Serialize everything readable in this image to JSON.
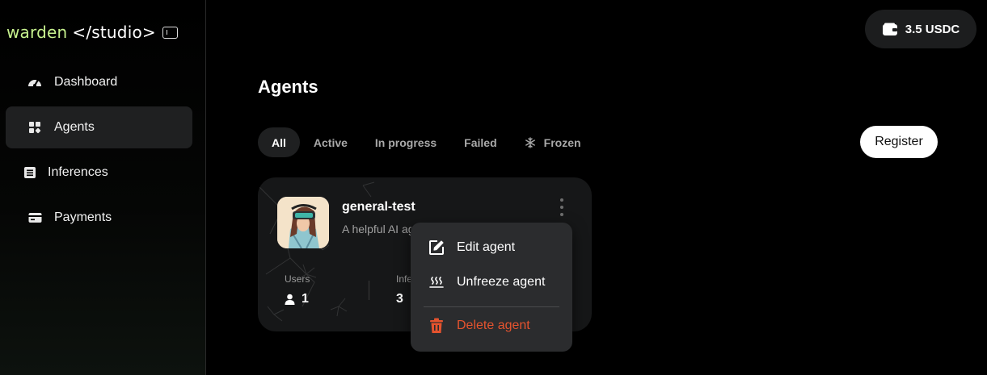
{
  "brand": {
    "logo_part1": "warden",
    "logo_part2": "</studio>"
  },
  "sidebar": {
    "items": [
      {
        "label": "Dashboard",
        "icon": "gauge-icon"
      },
      {
        "label": "Agents",
        "icon": "grid-icon",
        "active": true
      },
      {
        "label": "Inferences",
        "icon": "list-icon"
      },
      {
        "label": "Payments",
        "icon": "card-icon"
      }
    ]
  },
  "wallet": {
    "balance": "3.5 USDC"
  },
  "main": {
    "title": "Agents",
    "tabs": [
      {
        "label": "All",
        "active": true
      },
      {
        "label": "Active"
      },
      {
        "label": "In progress"
      },
      {
        "label": "Failed"
      },
      {
        "label": "Frozen",
        "icon": "snowflake-icon"
      }
    ],
    "register_label": "Register"
  },
  "agent_card": {
    "name": "general-test",
    "description": "A helpful AI ag",
    "users_label": "Users",
    "users_value": "1",
    "inferences_label": "Infe",
    "inferences_value": "3"
  },
  "context_menu": {
    "items": [
      {
        "label": "Edit agent",
        "icon": "edit-icon"
      },
      {
        "label": "Unfreeze agent",
        "icon": "heat-icon"
      },
      {
        "label": "Delete agent",
        "icon": "trash-icon"
      }
    ]
  },
  "colors": {
    "brand_accent": "#c7f28e",
    "danger": "#e5532e",
    "surface": "#1f2021",
    "menu_bg": "#2b2c2e"
  }
}
